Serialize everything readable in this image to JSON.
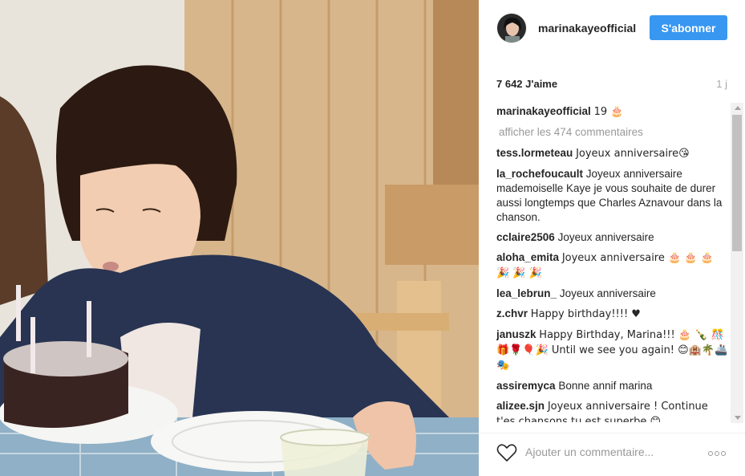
{
  "post": {
    "username": "marinakayeofficial",
    "follow_label": "S'abonner",
    "likes": "7 642 J'aime",
    "age": "1 j"
  },
  "caption": {
    "user": "marinakayeofficial",
    "text": "19 🎂"
  },
  "view_all_label": "afficher les 474 commentaires",
  "comments": [
    {
      "user": "tess.lormeteau",
      "text": "Joyeux anniversaire😘"
    },
    {
      "user": "la_rochefoucault",
      "text": "Joyeux anniversaire mademoiselle Kaye je vous souhaite de durer aussi longtemps que Charles Aznavour dans la chanson."
    },
    {
      "user": "cclaire2506",
      "text": "Joyeux anniversaire"
    },
    {
      "user": "aloha_emita",
      "text": "Joyeux anniversaire 🎂 🎂 🎂 🎉 🎉 🎉"
    },
    {
      "user": "lea_lebrun_",
      "text": "Joyeux anniversaire"
    },
    {
      "user": "z.chvr",
      "text": "Happy birthday!!!! ♥"
    },
    {
      "user": "januszk",
      "text": "Happy Birthday, Marina!!! 🎂 🍾 🎊🎁🌹🎈🎉 Until we see you again! 😊🏨🌴🚢🎭"
    },
    {
      "user": "assiremyca",
      "text": "Bonne annif marina"
    },
    {
      "user": "alizee.sjn",
      "text": "Joyeux anniversaire ! Continue t'es chansons tu est superbe 😊"
    }
  ],
  "footer": {
    "comment_placeholder": "Ajouter un commentaire...",
    "more_icon": "more-options-icon",
    "like_icon": "heart-icon"
  },
  "colors": {
    "accent": "#3897f0",
    "muted": "#999999"
  }
}
